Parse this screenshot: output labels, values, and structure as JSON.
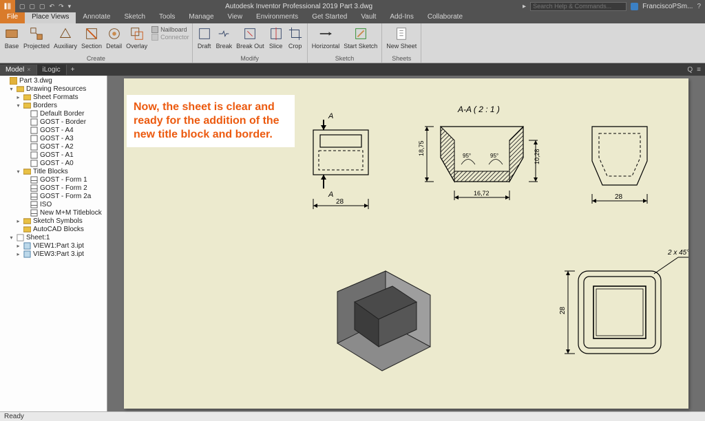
{
  "app": {
    "title": "Autodesk Inventor Professional 2019  Part 3.dwg"
  },
  "search": {
    "placeholder": "Search Help & Commands..."
  },
  "user": {
    "name": "FranciscoPSm..."
  },
  "menu": {
    "file": "File",
    "tabs": [
      "Place Views",
      "Annotate",
      "Sketch",
      "Tools",
      "Manage",
      "View",
      "Environments",
      "Get Started",
      "Vault",
      "Add-Ins",
      "Collaborate"
    ]
  },
  "ribbon": {
    "create": {
      "label": "Create",
      "buttons": [
        "Base",
        "Projected",
        "Auxiliary",
        "Section",
        "Detail",
        "Overlay"
      ],
      "side": {
        "nailboard": "Nailboard",
        "connector": "Connector"
      }
    },
    "modify": {
      "label": "Modify",
      "buttons": [
        "Draft",
        "Break",
        "Break Out",
        "Slice",
        "Crop"
      ]
    },
    "sketch": {
      "label": "Sketch",
      "buttons": [
        "Horizontal",
        "Start Sketch"
      ]
    },
    "sheets": {
      "label": "Sheets",
      "buttons": [
        "New Sheet"
      ]
    }
  },
  "panels": {
    "model": "Model",
    "ilogic": "iLogic"
  },
  "tree": {
    "root": "Part 3.dwg",
    "drawing_resources": "Drawing Resources",
    "sheet_formats": "Sheet Formats",
    "borders": "Borders",
    "border_items": [
      "Default Border",
      "GOST - Border",
      "GOST - A4",
      "GOST - A3",
      "GOST - A2",
      "GOST - A1",
      "GOST - A0"
    ],
    "title_blocks": "Title Blocks",
    "tb_items": [
      "GOST - Form 1",
      "GOST - Form 2",
      "GOST - Form 2a",
      "ISO",
      "New M+M Titleblock"
    ],
    "sketch_symbols": "Sketch Symbols",
    "autocad_blocks": "AutoCAD Blocks",
    "sheet1": "Sheet:1",
    "views": [
      "VIEW1:Part 3.ipt",
      "VIEW3:Part 3.ipt"
    ]
  },
  "annotation": "Now, the sheet is clear and ready for the addition of the new title block and border.",
  "views_data": {
    "a_label": "A",
    "section_title": "A-A ( 2 : 1 )",
    "dim_28": "28",
    "dim_1672": "16,72",
    "dim_1875": "18,75",
    "dim_1028": "10,28",
    "ang95a": "95°",
    "ang95b": "95°",
    "chamfer": "2 x 45°"
  },
  "status": {
    "text": "Ready"
  }
}
